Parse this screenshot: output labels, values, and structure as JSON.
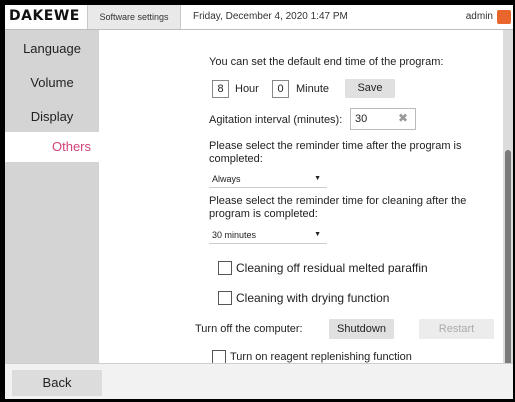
{
  "header": {
    "logo": "DAKEWE",
    "tab": "Software settings",
    "datetime": "Friday, December 4, 2020 1:47 PM",
    "user": "admin"
  },
  "sidebar": {
    "items": [
      {
        "label": "Language",
        "active": false
      },
      {
        "label": "Volume",
        "active": false
      },
      {
        "label": "Display",
        "active": false
      },
      {
        "label": "Others",
        "active": true
      }
    ]
  },
  "main": {
    "end_time_prompt": "You can set the default end time of the program:",
    "hour_value": "8",
    "hour_label": "Hour",
    "minute_value": "0",
    "minute_label": "Minute",
    "save_label": "Save",
    "agitation_label": "Agitation interval (minutes):",
    "agitation_value": "30",
    "reminder_prompt": "Please select the reminder time after the program is completed:",
    "reminder_value": "Always",
    "cleaning_prompt": "Please select the reminder time for cleaning after the program is completed:",
    "cleaning_value": "30 minutes",
    "checkbox_paraffin": "Cleaning off residual melted paraffin",
    "checkbox_drying": "Cleaning with drying function",
    "turn_off_label": "Turn off the computer:",
    "shutdown_label": "Shutdown",
    "restart_label": "Restart",
    "checkbox_reagent": "Turn on reagent replenishing function"
  },
  "footer": {
    "back_label": "Back"
  },
  "colors": {
    "accent_active": "#d1437a",
    "sidebar_bg": "#d4d4d4",
    "user_icon": "#e8652b"
  }
}
